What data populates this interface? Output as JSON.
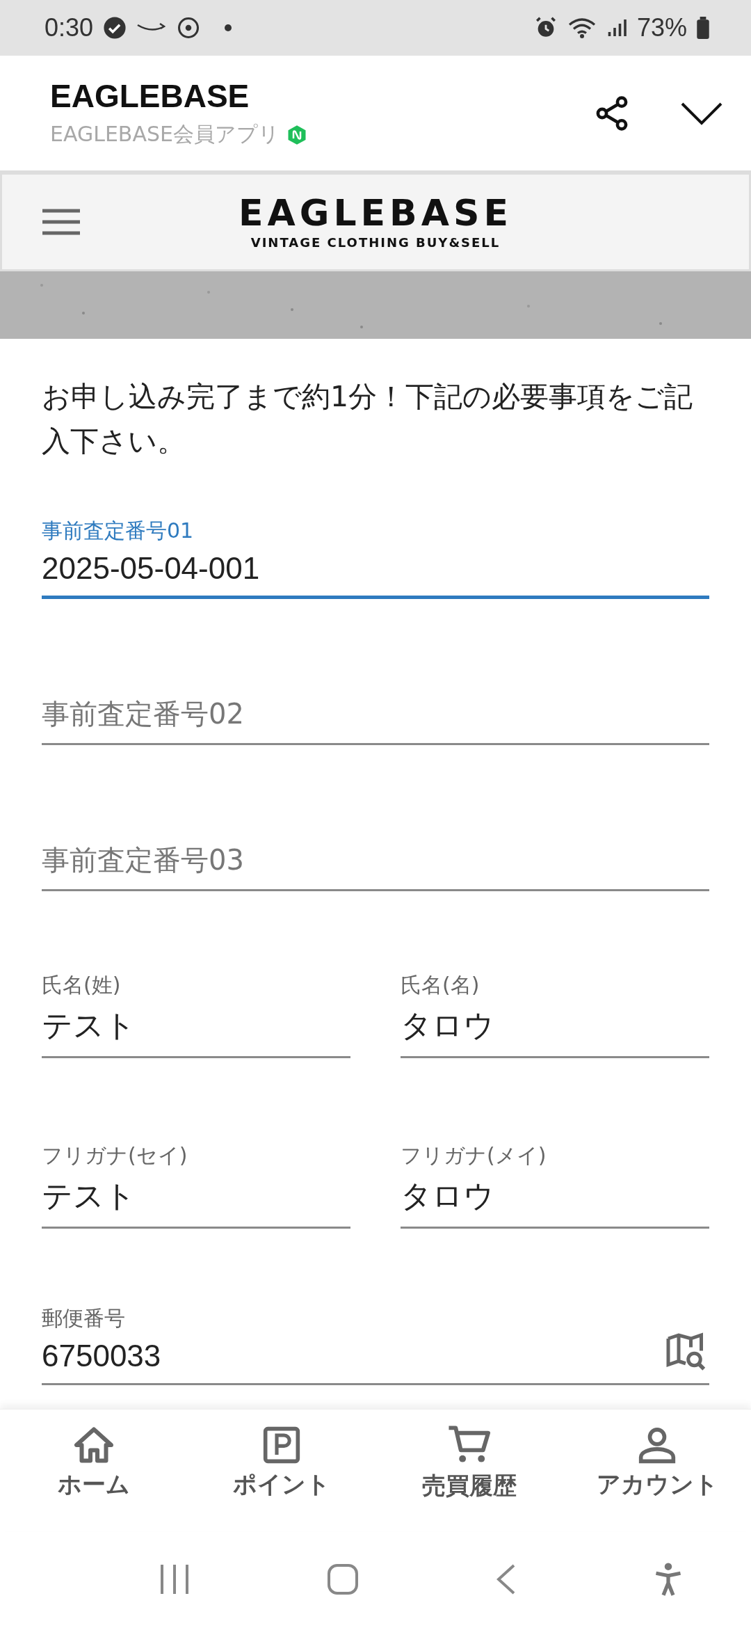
{
  "status_bar": {
    "time": "0:30",
    "battery": "73%"
  },
  "app_header": {
    "title": "EAGLEBASE",
    "subtitle": "EAGLEBASE会員アプリ"
  },
  "site_nav": {
    "logo": "EAGLEBASE",
    "tagline": "VINTAGE CLOTHING BUY&SELL"
  },
  "intro": "お申し込み完了まで約1分！下記の必要事項をご記入下さい。",
  "form_rows": [
    {
      "fields": [
        {
          "label": "事前査定番号01",
          "value": "2025-05-04-001",
          "focused": true
        }
      ]
    },
    {
      "fields": [
        {
          "placeholder": "事前査定番号02",
          "focused": false
        }
      ]
    },
    {
      "fields": [
        {
          "placeholder": "事前査定番号03",
          "focused": false
        }
      ]
    },
    {
      "fields": [
        {
          "label": "氏名(姓)",
          "value": "テスト",
          "focused": false
        },
        {
          "label": "氏名(名)",
          "value": "タロウ",
          "focused": false
        }
      ]
    },
    {
      "fields": [
        {
          "label": "フリガナ(セイ)",
          "value": "テスト",
          "focused": false
        },
        {
          "label": "フリガナ(メイ)",
          "value": "タロウ",
          "focused": false
        }
      ]
    },
    {
      "fields": [
        {
          "label": "郵便番号",
          "value": "6750033",
          "focused": false,
          "map_button": true
        }
      ]
    }
  ],
  "bottom_nav": [
    {
      "kind": "home",
      "label": "ホーム"
    },
    {
      "kind": "point",
      "label": "ポイント"
    },
    {
      "kind": "cart",
      "label": "売買履歴"
    },
    {
      "kind": "account",
      "label": "アカウント"
    }
  ]
}
